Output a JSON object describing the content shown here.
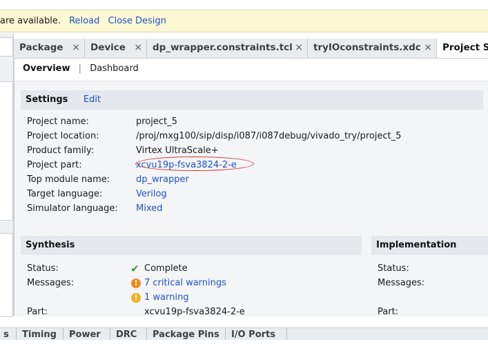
{
  "banner": {
    "text": "are available.",
    "reload_label": "Reload",
    "close_design_label": "Close Design",
    "bg_color": "#fdf8d4"
  },
  "tabs": [
    {
      "label": "Package",
      "close": "×"
    },
    {
      "label": "Device",
      "close": "×"
    },
    {
      "label": "dp_wrapper.constraints.tcl",
      "close": "×"
    },
    {
      "label": "tryIOconstraints.xdc",
      "close": "×"
    },
    {
      "label": "Project Su"
    }
  ],
  "subtabs": {
    "overview": "Overview",
    "dashboard": "Dashboard"
  },
  "settings": {
    "title": "Settings",
    "edit_label": "Edit",
    "rows": [
      {
        "label": "Project name:",
        "value": "project_5"
      },
      {
        "label": "Project location:",
        "value": "/proj/mxg100/sip/disp/i087/i087debug/vivado_try/project_5"
      },
      {
        "label": "Product family:",
        "value": "Virtex UltraScale+"
      },
      {
        "label": "Project part:",
        "value": "xcvu19p-fsva3824-2-e"
      },
      {
        "label": "Top module name:",
        "value": "dp_wrapper"
      },
      {
        "label": "Target language:",
        "value": "Verilog"
      },
      {
        "label": "Simulator language:",
        "value": "Mixed"
      }
    ]
  },
  "synthesis": {
    "title": "Synthesis",
    "status_label": "Status:",
    "status_value": "Complete",
    "messages_label": "Messages:",
    "critical_warnings": "7 critical warnings",
    "warnings": "1 warning",
    "part_label": "Part:",
    "part_value": "xcvu19p-fsva3824-2-e"
  },
  "implementation": {
    "title": "Implementation",
    "status_label": "Status:",
    "messages_label": "Messages:",
    "part_label": "Part:"
  },
  "bottom_tabs": [
    "s",
    "Timing",
    "Power",
    "DRC",
    "Package Pins",
    "I/O Ports"
  ],
  "icons": {
    "check": "✔",
    "warn": "!"
  },
  "colors": {
    "link": "#2050c8",
    "warning": "#f0a020",
    "critical": "#f08a18",
    "check": "#2e9b3a",
    "annotation": "#d42a2a"
  }
}
